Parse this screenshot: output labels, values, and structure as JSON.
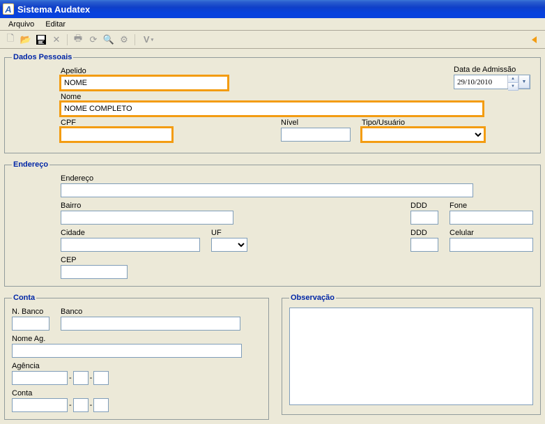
{
  "window": {
    "title": "Sistema Audatex"
  },
  "menu": {
    "arquivo": "Arquivo",
    "editar": "Editar"
  },
  "groups": {
    "dados_pessoais": "Dados Pessoais",
    "endereco": "Endereço",
    "conta": "Conta",
    "observacao": "Observação"
  },
  "dados": {
    "apelido_label": "Apelido",
    "apelido_value": "NOME",
    "nome_label": "Nome",
    "nome_value": "NOME COMPLETO",
    "cpf_label": "CPF",
    "cpf_value": "",
    "nivel_label": "Nível",
    "nivel_value": "",
    "tipo_label": "Tipo/Usuário",
    "tipo_value": "",
    "data_admissao_label": "Data de Admissão",
    "data_admissao_value": "29/10/2010"
  },
  "endereco": {
    "endereco_label": "Endereço",
    "endereco_value": "",
    "bairro_label": "Bairro",
    "bairro_value": "",
    "ddd1_label": "DDD",
    "ddd1_value": "",
    "fone_label": "Fone",
    "fone_value": "",
    "cidade_label": "Cidade",
    "cidade_value": "",
    "uf_label": "UF",
    "uf_value": "",
    "ddd2_label": "DDD",
    "ddd2_value": "",
    "celular_label": "Celular",
    "celular_value": "",
    "cep_label": "CEP",
    "cep_value": ""
  },
  "conta": {
    "nbanco_label": "N. Banco",
    "nbanco_value": "",
    "banco_label": "Banco",
    "banco_value": "",
    "nomeag_label": "Nome Ag.",
    "nomeag_value": "",
    "agencia_label": "Agência",
    "agencia_p1": "",
    "agencia_p2": "",
    "agencia_p3": "",
    "conta_label": "Conta",
    "conta_p1": "",
    "conta_p2": "",
    "conta_p3": ""
  },
  "observacao": {
    "value": ""
  },
  "toolbar": {
    "v_label": "V"
  }
}
